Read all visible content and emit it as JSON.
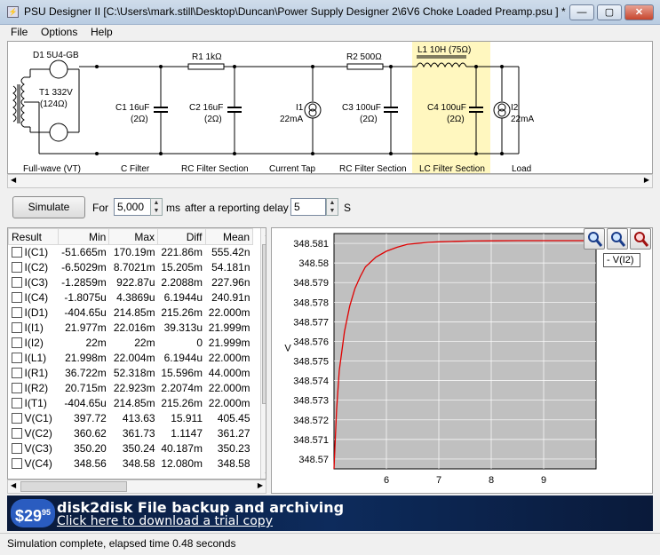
{
  "window": {
    "title": "PSU Designer II  [C:\\Users\\mark.still\\Desktop\\Duncan\\Power Supply Designer 2\\6V6 Choke Loaded Preamp.psu ] *",
    "min_label": "—",
    "max_label": "▢",
    "close_label": "✕"
  },
  "menu": [
    "File",
    "Options",
    "Help"
  ],
  "schematic": {
    "d1": "D1 5U4-GB",
    "t1": "T1 332V",
    "t1_r": "(124Ω)",
    "r1": "R1 1kΩ",
    "c1": "C1 16uF",
    "c1_r": "(2Ω)",
    "c2": "C2 16uF",
    "c2_r": "(2Ω)",
    "i1": "I1",
    "i1_v": "22mA",
    "r2": "R2 500Ω",
    "c3": "C3 100uF",
    "c3_r": "(2Ω)",
    "l1": "L1 10H (75Ω)",
    "c4": "C4 100uF",
    "c4_r": "(2Ω)",
    "i2": "I2",
    "i2_v": "22mA",
    "sections": [
      "Full-wave (VT)",
      "C Filter",
      "RC Filter Section",
      "Current Tap",
      "RC Filter Section",
      "LC Filter Section",
      "Load"
    ]
  },
  "toolbar": {
    "simulate_label": "Simulate",
    "for_label": "For",
    "duration": "5,000",
    "ms_label": "ms",
    "after_label": "after a reporting delay of",
    "delay": "5",
    "s_label": "S"
  },
  "results": {
    "headers": [
      "Result",
      "Min",
      "Max",
      "Diff",
      "Mean"
    ],
    "rows": [
      [
        "I(C1)",
        "-51.665m",
        "170.19m",
        "221.86m",
        "555.42n"
      ],
      [
        "I(C2)",
        "-6.5029m",
        "8.7021m",
        "15.205m",
        "54.181n"
      ],
      [
        "I(C3)",
        "-1.2859m",
        "922.87u",
        "2.2088m",
        "227.96n"
      ],
      [
        "I(C4)",
        "-1.8075u",
        "4.3869u",
        "6.1944u",
        "240.91n"
      ],
      [
        "I(D1)",
        "-404.65u",
        "214.85m",
        "215.26m",
        "22.000m"
      ],
      [
        "I(I1)",
        "21.977m",
        "22.016m",
        "39.313u",
        "21.999m"
      ],
      [
        "I(I2)",
        "22m",
        "22m",
        "0",
        "21.999m"
      ],
      [
        "I(L1)",
        "21.998m",
        "22.004m",
        "6.1944u",
        "22.000m"
      ],
      [
        "I(R1)",
        "36.722m",
        "52.318m",
        "15.596m",
        "44.000m"
      ],
      [
        "I(R2)",
        "20.715m",
        "22.923m",
        "2.2074m",
        "22.000m"
      ],
      [
        "I(T1)",
        "-404.65u",
        "214.85m",
        "215.26m",
        "22.000m"
      ],
      [
        "V(C1)",
        "397.72",
        "413.63",
        "15.911",
        "405.45"
      ],
      [
        "V(C2)",
        "360.62",
        "361.73",
        "1.1147",
        "361.27"
      ],
      [
        "V(C3)",
        "350.20",
        "350.24",
        "40.187m",
        "350.23"
      ],
      [
        "V(C4)",
        "348.56",
        "348.58",
        "12.080m",
        "348.58"
      ]
    ]
  },
  "chart_data": {
    "type": "line",
    "ylabel": "V",
    "ylim": [
      348.5695,
      348.5815
    ],
    "yticks": [
      "348.57",
      "348.571",
      "348.572",
      "348.573",
      "348.574",
      "348.575",
      "348.576",
      "348.577",
      "348.578",
      "348.579",
      "348.58",
      "348.581"
    ],
    "xlim": [
      5,
      10
    ],
    "xticks": [
      "6",
      "7",
      "8",
      "9"
    ],
    "series": [
      {
        "name": "V(I2)",
        "color": "#e00000",
        "x": [
          5.0,
          5.05,
          5.1,
          5.2,
          5.3,
          5.4,
          5.5,
          5.6,
          5.8,
          6.0,
          6.2,
          6.4,
          6.6,
          6.8,
          7.0,
          7.3,
          7.6,
          8.0,
          8.5,
          9.0,
          9.5,
          10.0
        ],
        "y": [
          348.5695,
          348.5725,
          348.5745,
          348.5765,
          348.5778,
          348.5787,
          348.5793,
          348.5798,
          348.5803,
          348.5806,
          348.5808,
          348.58095,
          348.581,
          348.58105,
          348.58108,
          348.5811,
          348.58112,
          348.58113,
          348.58114,
          348.58114,
          348.58114,
          348.58114
        ]
      }
    ],
    "grid": true,
    "legend": "top-right"
  },
  "ad": {
    "price": "$29",
    "price_cents": "95",
    "title": "disk2disk File backup and archiving",
    "link": "Click here to download a trial copy"
  },
  "status": "Simulation complete, elapsed time 0.48 seconds"
}
